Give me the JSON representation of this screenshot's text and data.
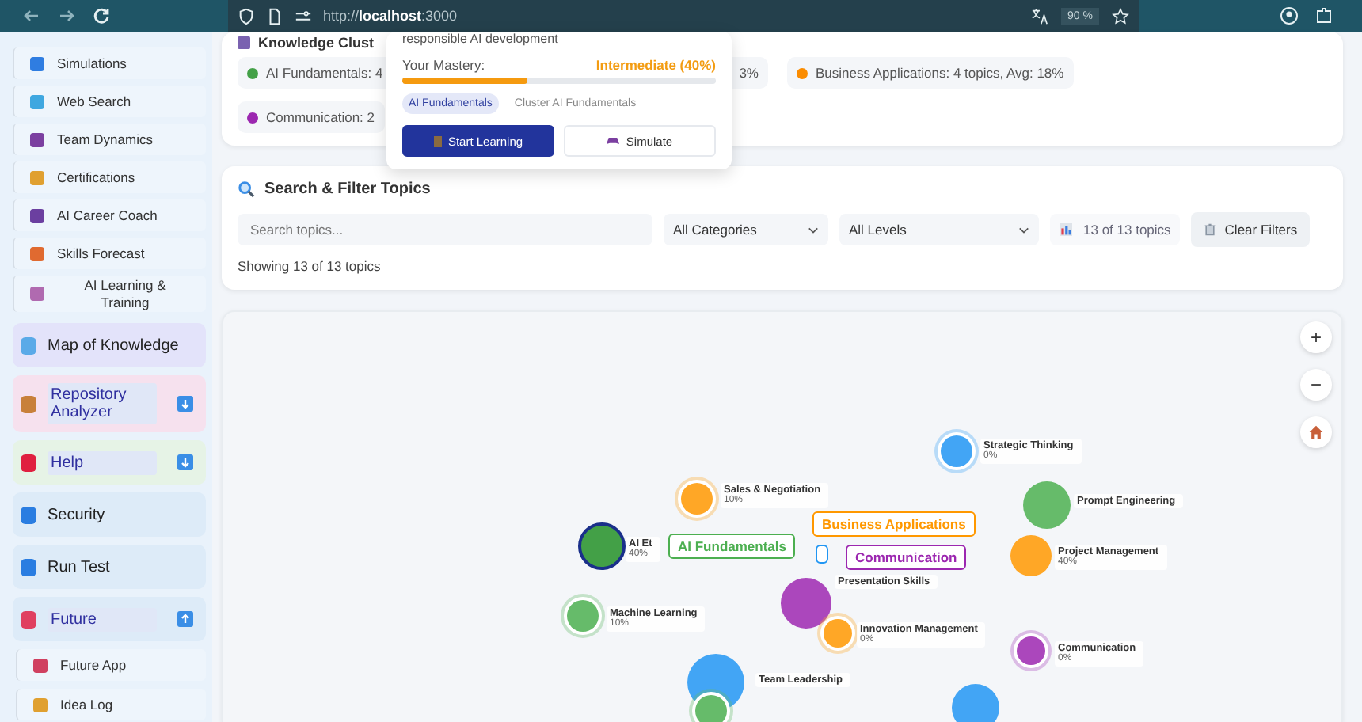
{
  "browser": {
    "url_prefix": "http://",
    "url_host": "localhost",
    "url_port": ":3000",
    "zoom": "90 %"
  },
  "sidebar": {
    "subitems": [
      "Simulations",
      "Web Search",
      "Team Dynamics",
      "Certifications",
      "AI Career Coach",
      "Skills Forecast",
      "AI Learning & Training"
    ],
    "sections": [
      {
        "label": "Map of Knowledge",
        "kind": "link",
        "color": "#e3e3fa"
      },
      {
        "label": "Repository Analyzer",
        "kind": "group",
        "color": "#f6e1ee",
        "expanded": false
      },
      {
        "label": "Help",
        "kind": "group",
        "color": "#e6f3e6",
        "expanded": false
      },
      {
        "label": "Security",
        "kind": "link",
        "color": "#ddebf8"
      },
      {
        "label": "Run Test",
        "kind": "link",
        "color": "#ddebf8"
      },
      {
        "label": "Future",
        "kind": "group",
        "color": "#ddebf8",
        "expanded": true,
        "children": [
          "Future App",
          "Idea Log"
        ]
      }
    ]
  },
  "clusters": {
    "title": "Knowledge Clust",
    "chips": [
      {
        "text": "AI Fundamentals: 4",
        "tail": "3%",
        "color": "#43a047"
      },
      {
        "text": "Business Applications: 4 topics, Avg: 18%",
        "color": "#fb8c00"
      },
      {
        "text": "Communication: 2",
        "color": "#9c27b0"
      }
    ]
  },
  "popup": {
    "description": "responsible AI development",
    "mastery_label": "Your Mastery:",
    "mastery_value": "Intermediate (40%)",
    "level": 0.4,
    "tags": [
      "AI Fundamentals",
      "Cluster AI Fundamentals"
    ],
    "primary_button": "Start Learning",
    "secondary_button": "Simulate"
  },
  "search": {
    "title": "Search & Filter Topics",
    "placeholder": "Search topics...",
    "category": "All Categories",
    "level_filter": "All Levels",
    "count": "13 of 13 topics",
    "clear_button": "Clear Filters",
    "showing": "Showing 13 of 13 topics"
  },
  "map": {
    "controls": [
      "+",
      "−"
    ],
    "clusters": [
      {
        "label": "AI Fundamentals",
        "color": "#4caf50"
      },
      {
        "label": "Business Applications",
        "color": "#ff9800"
      },
      {
        "color": "#2196f3"
      },
      {
        "label": "Communication",
        "color": "#9c27b0"
      }
    ],
    "nodes": [
      {
        "name": "Strategic Thinking",
        "progress": "0%",
        "color": "#42a5f5"
      },
      {
        "name": "Sales & Negotiation",
        "progress": "10%",
        "color": "#ffa726"
      },
      {
        "name": "Prompt Engineering",
        "color": "#66bb6a"
      },
      {
        "name": "Project Management",
        "progress": "40%",
        "color": "#ffa726"
      },
      {
        "name": "AI Et",
        "progress": "40%",
        "color": "#43a047"
      },
      {
        "name": "Presentation Skills",
        "color": "#ab47bc"
      },
      {
        "name": "Machine Learning",
        "progress": "10%",
        "color": "#66bb6a"
      },
      {
        "name": "Innovation Management",
        "progress": "0%",
        "color": "#ffa726"
      },
      {
        "name": "Communication",
        "progress": "0%",
        "color": "#ab47bc"
      },
      {
        "name": "Team Leadership",
        "color": "#42a5f5"
      },
      {
        "color": "#66bb6a"
      },
      {
        "color": "#42a5f5"
      }
    ]
  }
}
